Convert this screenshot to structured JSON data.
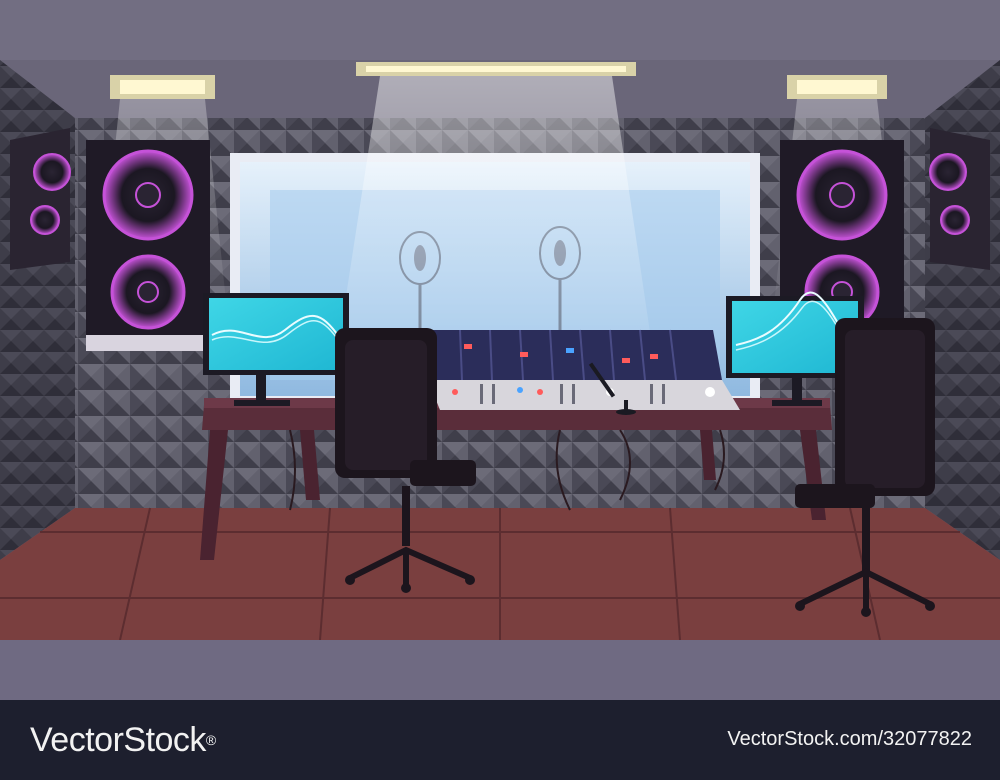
{
  "watermark": {
    "brand": "VectorStock",
    "registered_mark": "®",
    "reference": "VectorStock.com/32077822"
  },
  "screens": {
    "left_waveform_color": "#4fe6ee",
    "right_waveform_color": "#4fe6ee"
  },
  "colors": {
    "wall": "#5e5d6a",
    "floor": "#7a3f3f",
    "speaker_glow": "#c552d8",
    "window_glass": "#bcd9f0",
    "desk": "#5a2d3a",
    "chair": "#1c151d",
    "fader_red": "#ff5b5b",
    "fader_blue": "#4aa3ff"
  }
}
